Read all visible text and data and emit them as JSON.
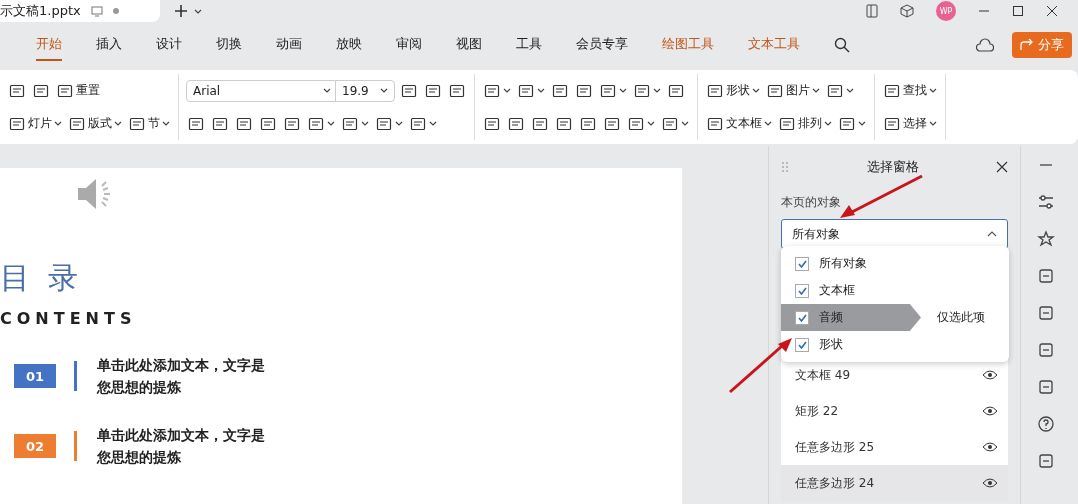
{
  "tabs": [
    {
      "label": "示文稿1.pptx",
      "selected": true
    }
  ],
  "menu": [
    {
      "label": "开始",
      "kind": "main",
      "selected": true
    },
    {
      "label": "插入",
      "kind": "main",
      "selected": false
    },
    {
      "label": "设计",
      "kind": "main",
      "selected": false
    },
    {
      "label": "切换",
      "kind": "main",
      "selected": false
    },
    {
      "label": "动画",
      "kind": "main",
      "selected": false
    },
    {
      "label": "放映",
      "kind": "main",
      "selected": false
    },
    {
      "label": "审阅",
      "kind": "main",
      "selected": false
    },
    {
      "label": "视图",
      "kind": "main",
      "selected": false
    },
    {
      "label": "工具",
      "kind": "main",
      "selected": false
    },
    {
      "label": "会员专享",
      "kind": "main",
      "selected": false
    },
    {
      "label": "绘图工具",
      "kind": "context",
      "selected": false
    },
    {
      "label": "文本工具",
      "kind": "context",
      "selected": false
    }
  ],
  "avatar": "WP",
  "share_button": "分享",
  "ribbon": [
    {
      "top": [
        {
          "kind": "button"
        },
        {
          "kind": "button"
        },
        {
          "kind": "button",
          "label": "重置"
        }
      ],
      "bottom": [
        {
          "kind": "menu-button",
          "label": "灯片"
        },
        {
          "kind": "menu-button",
          "label": "版式"
        },
        {
          "kind": "menu-button",
          "label": "节"
        }
      ]
    },
    {
      "top": [
        {
          "kind": "font-field",
          "value": "Arial"
        },
        {
          "kind": "size-field",
          "value": "19.9"
        },
        {
          "kind": "button"
        },
        {
          "kind": "button"
        },
        {
          "kind": "button"
        }
      ],
      "bottom": [
        {
          "kind": "button"
        },
        {
          "kind": "button"
        },
        {
          "kind": "button"
        },
        {
          "kind": "button"
        },
        {
          "kind": "button"
        },
        {
          "kind": "menu-button"
        },
        {
          "kind": "menu-button"
        },
        {
          "kind": "menu-button"
        },
        {
          "kind": "menu-button"
        }
      ]
    },
    {
      "top": [
        {
          "kind": "menu-button"
        },
        {
          "kind": "menu-button"
        },
        {
          "kind": "button"
        },
        {
          "kind": "button"
        },
        {
          "kind": "menu-button"
        },
        {
          "kind": "menu-button"
        },
        {
          "kind": "button"
        }
      ],
      "bottom": [
        {
          "kind": "button"
        },
        {
          "kind": "button"
        },
        {
          "kind": "button"
        },
        {
          "kind": "button"
        },
        {
          "kind": "button"
        },
        {
          "kind": "button"
        },
        {
          "kind": "menu-button"
        },
        {
          "kind": "menu-button"
        }
      ]
    },
    {
      "top": [
        {
          "kind": "menu-button",
          "label": "形状"
        },
        {
          "kind": "menu-button",
          "label": "图片"
        },
        {
          "kind": "menu-button"
        }
      ],
      "bottom": [
        {
          "kind": "menu-button",
          "label": "文本框"
        },
        {
          "kind": "menu-button",
          "label": "排列"
        },
        {
          "kind": "menu-button"
        }
      ]
    },
    {
      "top": [
        {
          "kind": "menu-button",
          "label": "查找"
        }
      ],
      "bottom": [
        {
          "kind": "menu-button",
          "label": "选择"
        }
      ]
    }
  ],
  "slide": {
    "heading": "目 录",
    "subheading": "CONTENTS",
    "items": [
      {
        "number": "01",
        "color": "#4472c4",
        "lines": [
          "单击此处添加文本，文字是",
          "您思想的提炼"
        ]
      },
      {
        "number": "02",
        "color": "#ed7d31",
        "lines": [
          "单击此处添加文本，文字是",
          "您思想的提炼"
        ]
      }
    ]
  },
  "pane": {
    "title": "选择窗格",
    "section_label": "本页的对象",
    "filter": {
      "value": "所有对象",
      "expanded": true
    },
    "options": [
      {
        "label": "所有对象",
        "checked": true,
        "selected": false
      },
      {
        "label": "文本框",
        "checked": true,
        "selected": false
      },
      {
        "label": "音频",
        "checked": true,
        "selected": true
      },
      {
        "label": "形状",
        "checked": true,
        "selected": false
      }
    ],
    "tooltip": "仅选此项",
    "objects": [
      {
        "label": "文本框 49",
        "visible": true,
        "selected": false
      },
      {
        "label": "矩形 22",
        "visible": true,
        "selected": false
      },
      {
        "label": "任意多边形 25",
        "visible": true,
        "selected": false
      },
      {
        "label": "任意多边形 24",
        "visible": true,
        "selected": true
      }
    ]
  }
}
